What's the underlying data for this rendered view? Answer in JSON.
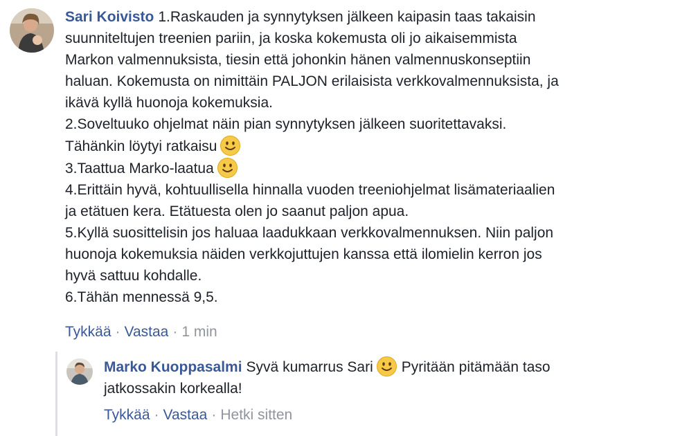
{
  "comment": {
    "author": "Sari Koivisto",
    "lines": [
      "1.Raskauden ja synnytyksen jälkeen kaipasin taas takaisin",
      "suunniteltujen treenien pariin, ja koska kokemusta oli jo aikaisemmista",
      "Markon valmennuksista, tiesin että johonkin hänen valmennuskonseptiin",
      "haluan. Kokemusta on nimittäin PALJON erilaisista verkkovalmennuksista, ja",
      "ikävä kyllä huonoja kokemuksia.",
      "2.Soveltuuko ohjelmat näin pian synnytyksen jälkeen suoritettavaksi.",
      "Tähänkin löytyi ratkaisu",
      "3.Taattua Marko-laatua",
      "4.Erittäin hyvä, kohtuullisella hinnalla vuoden treeniohjelmat lisämateriaalien",
      "ja etätuen kera. Etätuesta olen jo saanut paljon apua.",
      "5.Kyllä suosittelisin jos haluaa laadukkaan verkkovalmennuksen. Niin paljon",
      "huonoja kokemuksia näiden verkkojuttujen kanssa että ilomielin kerron jos",
      "hyvä sattuu kohdalle.",
      "6.Tähän mennessä 9,5."
    ],
    "like_label": "Tykkää",
    "reply_label": "Vastaa",
    "separator": "·",
    "timestamp": "1 min"
  },
  "reply": {
    "author": "Marko Kuoppasalmi",
    "line1_a": "Syvä kumarrus Sari",
    "line1_b": "Pyritään pitämään taso",
    "line2": "jatkossakin korkealla!",
    "like_label": "Tykkää",
    "reply_label": "Vastaa",
    "separator": "·",
    "timestamp": "Hetki sitten"
  },
  "colors": {
    "author": "#385898",
    "text": "#1d2129",
    "meta": "#90949c",
    "thread_line": "#dddfe2",
    "emoji": "#f7c948"
  }
}
